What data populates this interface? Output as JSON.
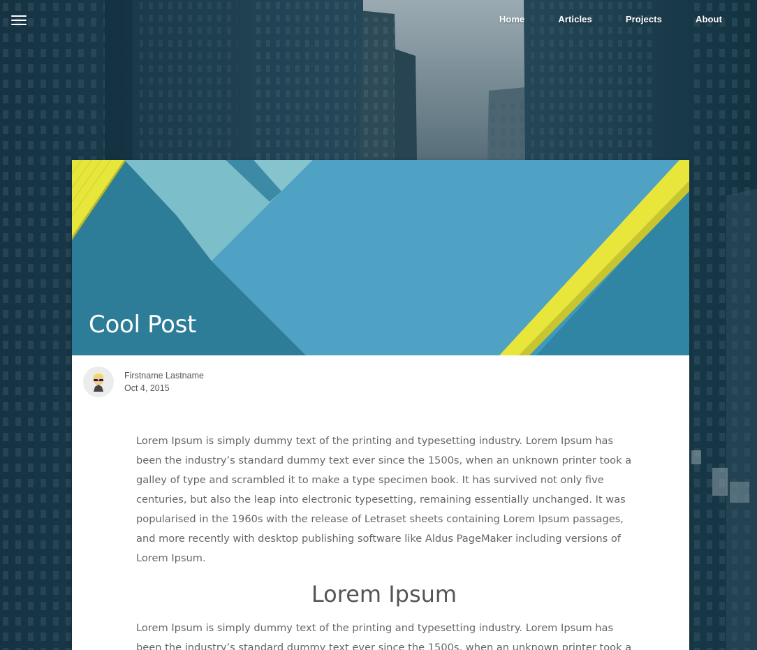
{
  "nav": {
    "items": [
      {
        "label": "Home"
      },
      {
        "label": "Articles"
      },
      {
        "label": "Projects"
      },
      {
        "label": "About"
      }
    ]
  },
  "post": {
    "title": "Cool Post",
    "author": "Firstname Lastname",
    "date": "Oct 4, 2015",
    "paragraph1": "Lorem Ipsum is simply dummy text of the printing and typesetting industry. Lorem Ipsum has been the industry’s standard dummy text ever since the 1500s, when an unknown printer took a galley of type and scrambled it to make a type specimen book. It has survived not only five centuries, but also the leap into electronic typesetting, remaining essentially unchanged. It was popularised in the 1960s with the release of Letraset sheets containing Lorem Ipsum passages, and more recently with desktop publishing software like Aldus PageMaker including versions of Lorem Ipsum.",
    "heading": "Lorem Ipsum",
    "paragraph2": "Lorem Ipsum is simply dummy text of the printing and typesetting industry. Lorem Ipsum has been the industry’s standard dummy text ever since the 1500s, when an unknown printer took a galley of type and scrambled it to make a type specimen book."
  },
  "icons": {
    "menu": "hamburger-menu-icon",
    "avatar": "avatar-cartoon"
  },
  "colors": {
    "hero_blue": "#3e9abd",
    "hero_accent_yellow": "#e5e23a",
    "background_teal": "#1d3d4d"
  }
}
